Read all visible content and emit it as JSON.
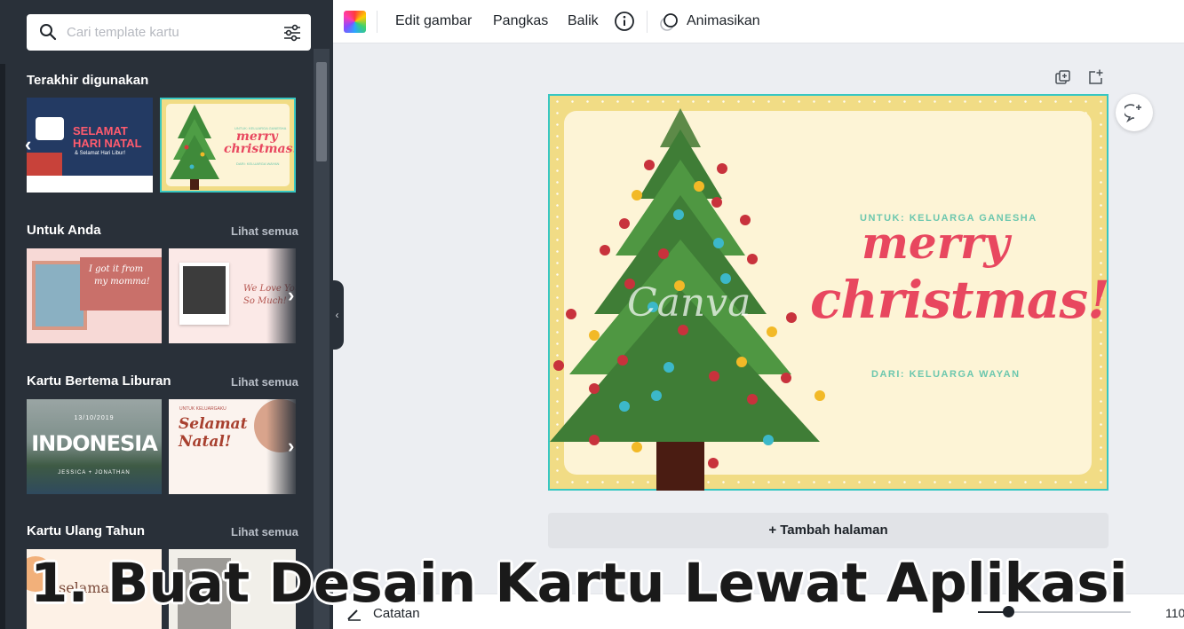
{
  "sidebar": {
    "search_placeholder": "Cari template kartu",
    "sections": [
      {
        "title": "Terakhir digunakan",
        "see_all": ""
      },
      {
        "title": "Untuk Anda",
        "see_all": "Lihat semua"
      },
      {
        "title": "Kartu Bertema Liburan",
        "see_all": "Lihat semua"
      },
      {
        "title": "Kartu Ulang Tahun",
        "see_all": "Lihat semua"
      }
    ],
    "thumbs": {
      "natal_line1": "SELAMAT",
      "natal_line2": "HARI NATAL",
      "natal_line3": "& Selamat Hari Libur!",
      "mini_to": "UNTUK: KELUARGA GANESHA",
      "mini_merry": "merry",
      "mini_christmas": "christmas!",
      "mini_from": "DARI: KELUARGA WAYAN",
      "momma_line1": "I got it from",
      "momma_line2": "my momma!",
      "love_line1": "We Love You",
      "love_line2": "So Much!",
      "indo_date": "13/10/2019",
      "indo_title": "INDONESIA",
      "indo_names": "JESSICA + JONATHAN",
      "natal2_small": "UNTUK KELUARGAKU",
      "natal2_line1": "Selamat",
      "natal2_line2": "Natal!",
      "bday_text": "selama"
    }
  },
  "toolbar": {
    "edit": "Edit gambar",
    "crop": "Pangkas",
    "flip": "Balik",
    "animate": "Animasikan"
  },
  "card": {
    "to": "UNTUK: KELUARGA GANESHA",
    "merry": "merry",
    "christmas": "christmas!",
    "from": "DARI: KELUARGA WAYAN",
    "watermark": "Canva"
  },
  "add_page": "+ Tambah halaman",
  "bottom": {
    "notes": "Catatan",
    "zoom_value": "110",
    "zoom_fraction": 0.2
  },
  "caption": "1. Buat Desain Kartu Lewat Aplikasi",
  "colors": {
    "sidebar_bg": "#293039",
    "accent_selection": "#38c7c2",
    "card_red": "#e8475f",
    "card_teal": "#6cc7ae"
  }
}
